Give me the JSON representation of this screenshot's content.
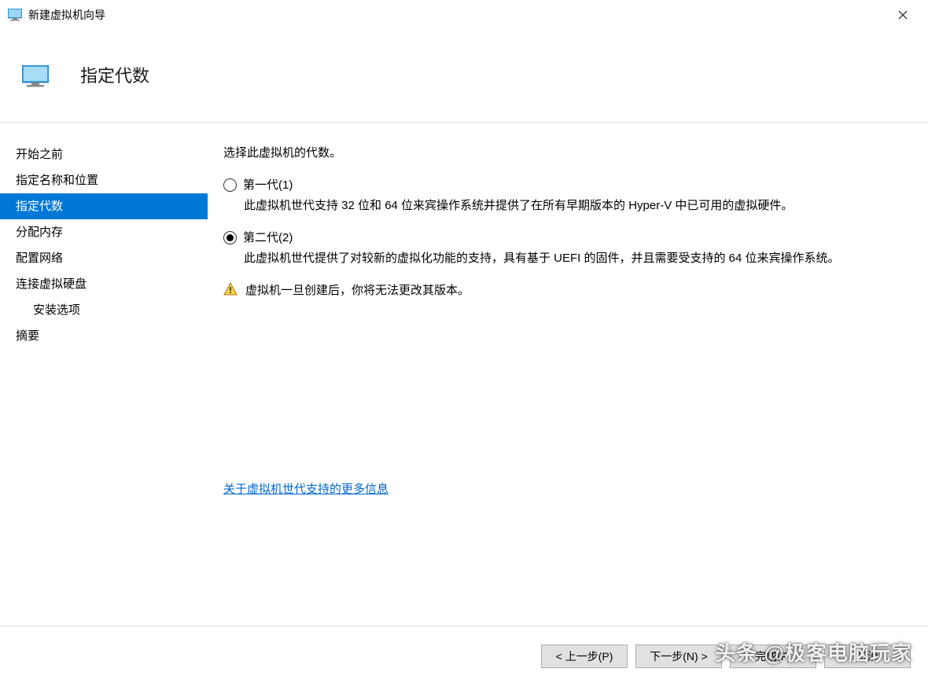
{
  "window": {
    "title": "新建虚拟机向导"
  },
  "header": {
    "title": "指定代数"
  },
  "sidebar": {
    "items": [
      {
        "label": "开始之前",
        "active": false
      },
      {
        "label": "指定名称和位置",
        "active": false
      },
      {
        "label": "指定代数",
        "active": true
      },
      {
        "label": "分配内存",
        "active": false
      },
      {
        "label": "配置网络",
        "active": false
      },
      {
        "label": "连接虚拟硬盘",
        "active": false
      },
      {
        "label": "安装选项",
        "active": false,
        "child": true
      },
      {
        "label": "摘要",
        "active": false
      }
    ]
  },
  "content": {
    "instruction": "选择此虚拟机的代数。",
    "options": [
      {
        "label": "第一代(1)",
        "selected": false,
        "description": "此虚拟机世代支持 32 位和 64 位来宾操作系统并提供了在所有早期版本的 Hyper-V 中已可用的虚拟硬件。"
      },
      {
        "label": "第二代(2)",
        "selected": true,
        "description": "此虚拟机世代提供了对较新的虚拟化功能的支持，具有基于 UEFI 的固件，并且需要受支持的 64 位来宾操作系统。"
      }
    ],
    "warning": "虚拟机一旦创建后，你将无法更改其版本。",
    "more_link": "关于虚拟机世代支持的更多信息"
  },
  "footer": {
    "prev": "< 上一步(P)",
    "next": "下一步(N) >",
    "finish": "完成(F)",
    "cancel": "取消"
  },
  "watermark": "头条 @极客电脑玩家"
}
